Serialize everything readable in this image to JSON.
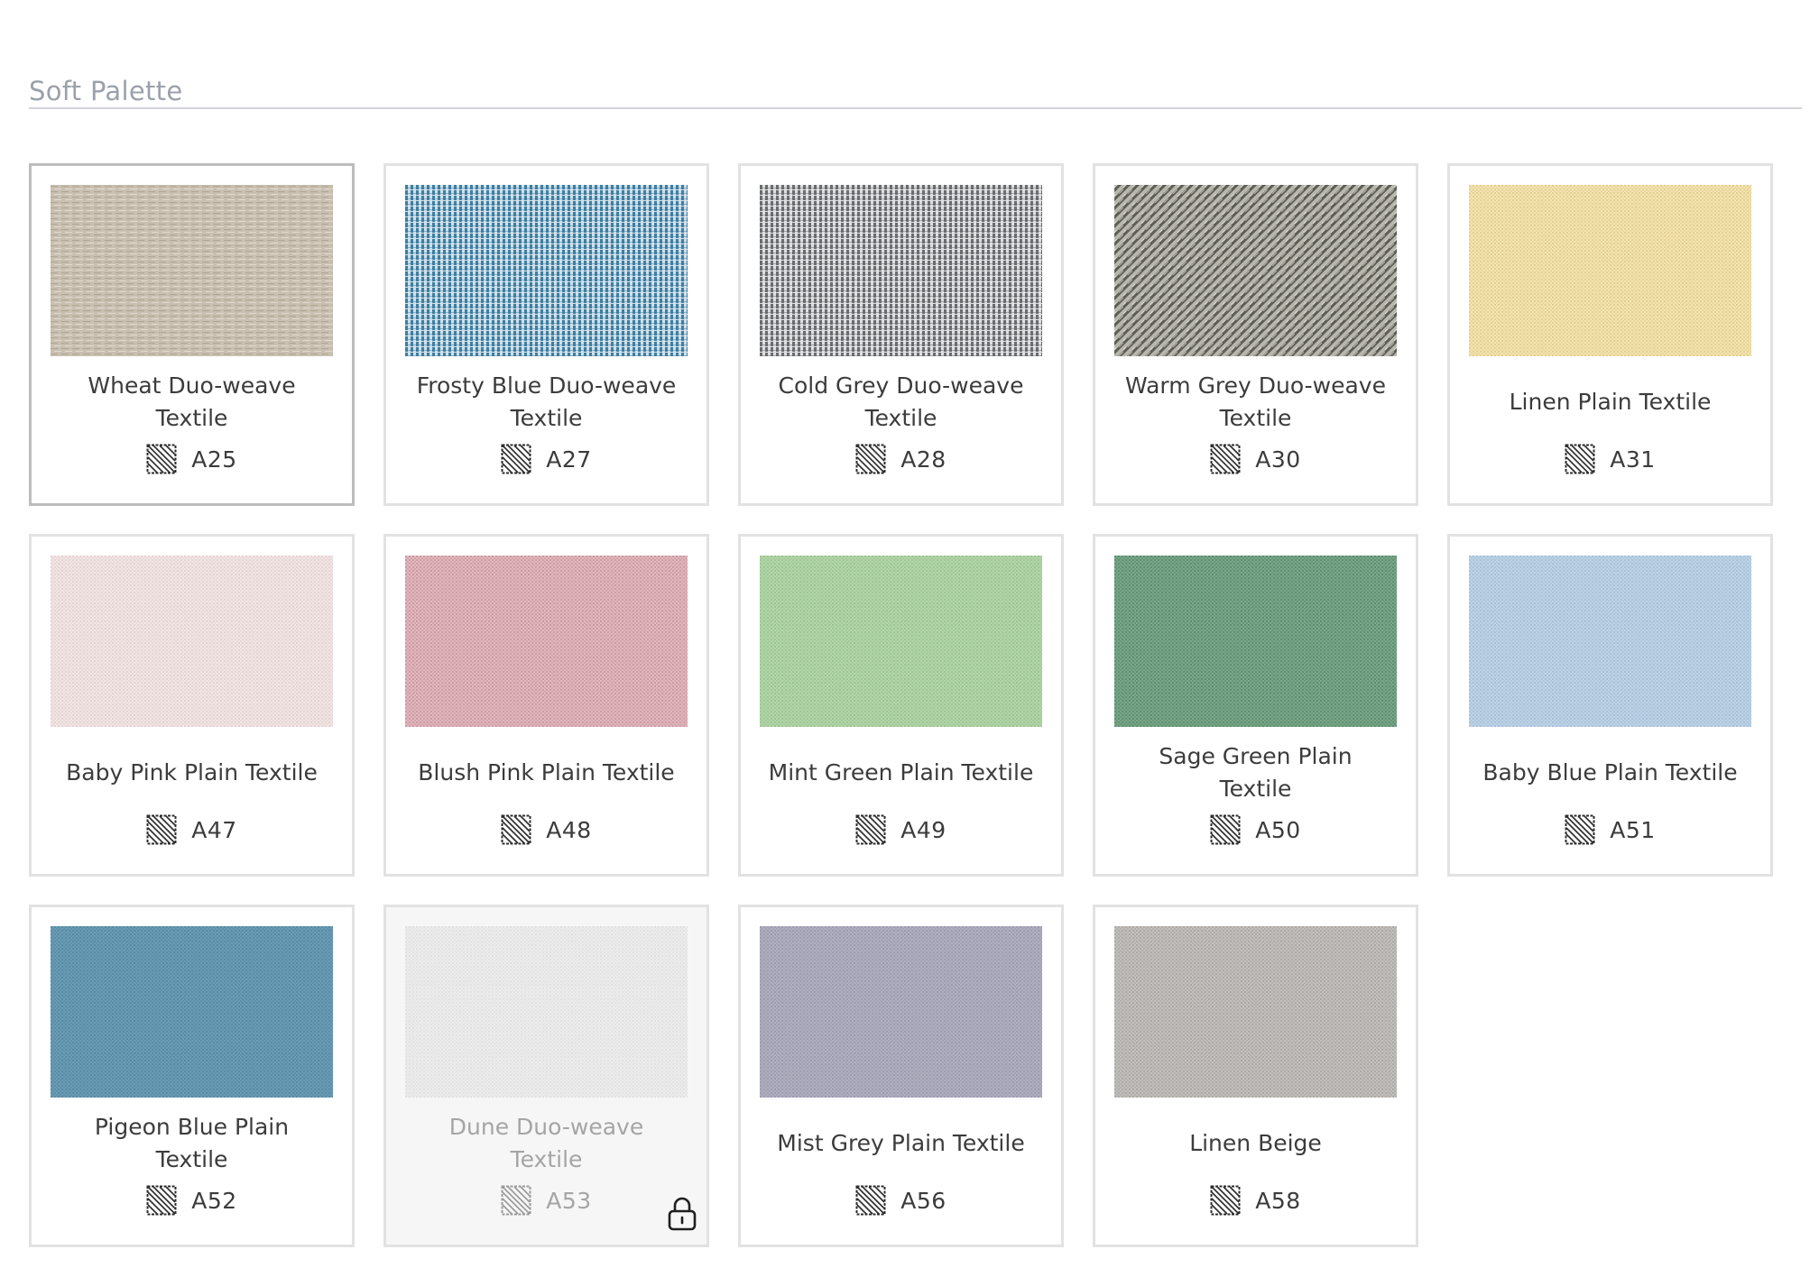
{
  "section": {
    "title": "Soft Palette"
  },
  "swatches": [
    {
      "name": "Wheat Duo-weave Textile",
      "code": "A25",
      "color": "#c9c0b1",
      "thread": "#a79d8c",
      "weave": "duo",
      "selected": true,
      "locked": false,
      "code_icon": "hatch-pattern-icon"
    },
    {
      "name": "Frosty Blue Duo-weave Textile",
      "code": "A27",
      "color": "#cfe0ea",
      "thread": "#3f7ea1",
      "weave": "grid",
      "selected": false,
      "locked": false,
      "code_icon": "hatch-pattern-icon"
    },
    {
      "name": "Cold Grey Duo-weave Textile",
      "code": "A28",
      "color": "#dedfe1",
      "thread": "#6a6c70",
      "weave": "grid",
      "selected": false,
      "locked": false,
      "code_icon": "hatch-pattern-icon"
    },
    {
      "name": "Warm Grey Duo-weave Textile",
      "code": "A30",
      "color": "#b9b6ac",
      "thread": "#5d5c55",
      "weave": "twill",
      "selected": false,
      "locked": false,
      "code_icon": "hatch-pattern-icon"
    },
    {
      "name": "Linen Plain Textile",
      "code": "A31",
      "color": "#f3e3ae",
      "thread": "#d8c282",
      "weave": "plain",
      "selected": false,
      "locked": false,
      "code_icon": "hatch-pattern-icon"
    },
    {
      "name": "Baby Pink Plain Textile",
      "code": "A47",
      "color": "#f1e5e4",
      "thread": "#d8c8c6",
      "weave": "plain",
      "selected": false,
      "locked": false,
      "code_icon": "hatch-pattern-icon"
    },
    {
      "name": "Blush Pink Plain Textile",
      "code": "A48",
      "color": "#e2b6bd",
      "thread": "#b98891",
      "weave": "plain",
      "selected": false,
      "locked": false,
      "code_icon": "hatch-pattern-icon"
    },
    {
      "name": "Mint Green Plain Textile",
      "code": "A49",
      "color": "#b2d5a8",
      "thread": "#8fb985",
      "weave": "plain",
      "selected": false,
      "locked": false,
      "code_icon": "hatch-pattern-icon"
    },
    {
      "name": "Sage Green Plain Textile",
      "code": "A50",
      "color": "#78a788",
      "thread": "#4b7d5d",
      "weave": "plain",
      "selected": false,
      "locked": false,
      "code_icon": "hatch-pattern-icon"
    },
    {
      "name": "Baby Blue Plain Textile",
      "code": "A51",
      "color": "#bdd2e6",
      "thread": "#9bb5cf",
      "weave": "plain",
      "selected": false,
      "locked": false,
      "code_icon": "hatch-pattern-icon"
    },
    {
      "name": "Pigeon Blue Plain Textile",
      "code": "A52",
      "color": "#6b9bb4",
      "thread": "#4b7f99",
      "weave": "plain",
      "selected": false,
      "locked": false,
      "code_icon": "hatch-pattern-icon"
    },
    {
      "name": "Dune Duo-weave Textile",
      "code": "A53",
      "color": "#e4e4e4",
      "thread": "#c5c5c5",
      "weave": "plain",
      "selected": false,
      "locked": true,
      "code_icon": "hatch-pattern-icon",
      "status_icon": "lock-icon"
    },
    {
      "name": "Mist Grey Plain Textile",
      "code": "A56",
      "color": "#aeaebf",
      "thread": "#9192a6",
      "weave": "plain",
      "selected": false,
      "locked": false,
      "code_icon": "hatch-pattern-icon"
    },
    {
      "name": "Linen Beige",
      "code": "A58",
      "color": "#c2bebb",
      "thread": "#9e9894",
      "weave": "plain",
      "selected": false,
      "locked": false,
      "code_icon": "hatch-pattern-icon"
    }
  ]
}
